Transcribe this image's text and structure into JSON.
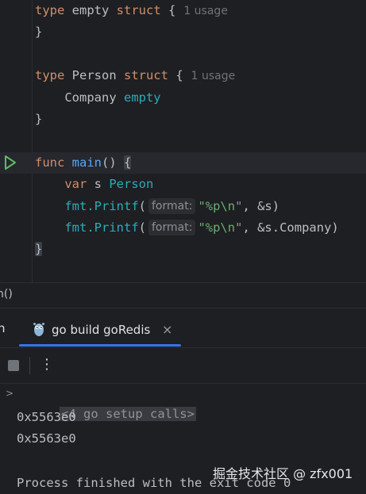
{
  "editor": {
    "lines": {
      "l1": {
        "kw": "type",
        "name": " empty ",
        "kw2": "struct",
        "brace": " {",
        "hint": "1 usage"
      },
      "l2": {
        "text": "}"
      },
      "l4": {
        "kw": "type",
        "name": " Person ",
        "kw2": "struct",
        "brace": " {",
        "hint": "1 usage"
      },
      "l5": {
        "field": "    Company ",
        "type": "empty"
      },
      "l6": {
        "text": "}"
      },
      "l8": {
        "kw": "func",
        "sp": " ",
        "fn": "main",
        "rest": "() ",
        "brace": "{"
      },
      "l9": {
        "indent": "    ",
        "kw": "var",
        "name": " s ",
        "type": "Person"
      },
      "l10": {
        "indent": "    ",
        "call": "fmt.",
        "fn": "Printf",
        "open": "(",
        "param": "format:",
        "str": "\"%p\\n\"",
        "rest": ", &s)"
      },
      "l11": {
        "indent": "    ",
        "call": "fmt.",
        "fn": "Printf",
        "open": "(",
        "param": "format:",
        "str": "\"%p\\n\"",
        "rest": ", &s.Company)"
      },
      "l12": {
        "text": "}"
      }
    }
  },
  "breadcrumb": {
    "text": "n()"
  },
  "run_panel": {
    "tab_stub": "n",
    "tab_label": "go build goRedis",
    "close_glyph": "×",
    "more_glyph": "⋮",
    "console": {
      "fold_arrow": ">",
      "setup_calls": "<4 go setup calls>",
      "out1": "0x5563e0",
      "out2": "0x5563e0",
      "finished": "Process finished with the exit code 0"
    }
  },
  "watermark": {
    "text": "掘金技术社区 @ zfx001"
  },
  "colors": {
    "background": "#1e1f22",
    "keyword": "#cf8e6d",
    "type": "#2aacb8",
    "function": "#56a8f5",
    "string": "#6aab73",
    "run_icon": "#5fb865",
    "tab_underline": "#3574f0"
  },
  "icons": {
    "run": "run-gutter-icon",
    "gopher": "go-gopher-icon",
    "stop": "stop-icon",
    "more": "more-vertical-icon",
    "close": "close-icon"
  }
}
